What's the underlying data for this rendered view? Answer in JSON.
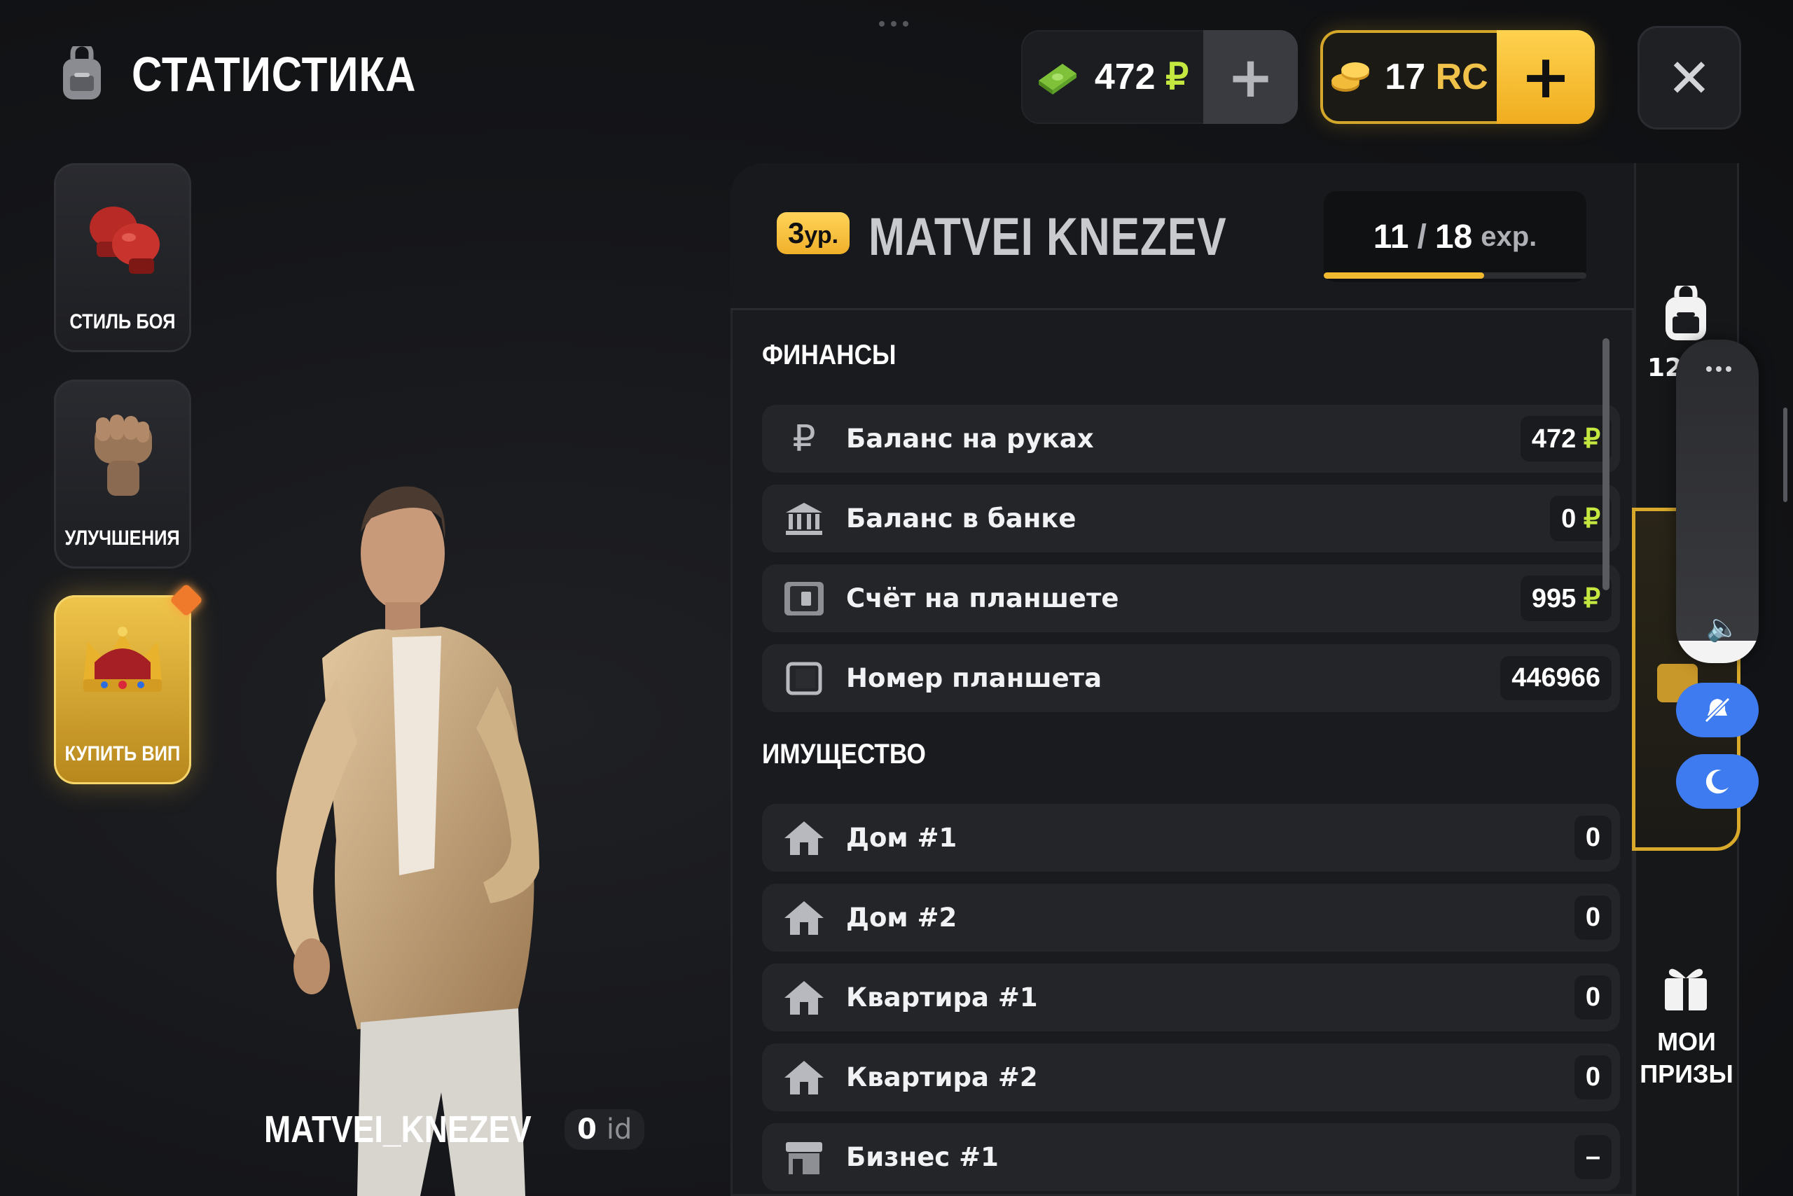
{
  "header": {
    "title": "СТАТИСТИКА"
  },
  "currency": {
    "money_value": "472",
    "money_symbol": "₽",
    "rc_value": "17",
    "rc_symbol": "RC",
    "plus": "+"
  },
  "close_label": "✕",
  "menu": [
    {
      "label": "СТИЛЬ БОЯ",
      "icon": "boxing-gloves-icon"
    },
    {
      "label": "УЛУЧШЕНИЯ",
      "icon": "fist-icon"
    },
    {
      "label": "КУПИТЬ ВИП",
      "icon": "crown-icon"
    }
  ],
  "player": {
    "name": "MATVEI_KNEZEV",
    "id_value": "0",
    "id_word": "id"
  },
  "panel": {
    "level_num": "3",
    "level_suffix": "ур.",
    "title": "MATVEI KNEZEV",
    "exp_current": "11",
    "exp_sep": "/",
    "exp_total": "18",
    "exp_word": "exp.",
    "exp_progress": 0.611
  },
  "finances": {
    "title": "ФИНАНСЫ",
    "rows": [
      {
        "label": "Баланс на руках",
        "value": "472",
        "suffix": "₽",
        "icon": "ruble-icon"
      },
      {
        "label": "Баланс в банке",
        "value": "0",
        "suffix": "₽",
        "icon": "bank-icon"
      },
      {
        "label": "Счёт на планшете",
        "value": "995",
        "suffix": "₽",
        "icon": "tablet-wallet-icon"
      },
      {
        "label": "Номер планшета",
        "value": "446966",
        "suffix": "",
        "icon": "tablet-icon"
      }
    ]
  },
  "property": {
    "title": "ИМУЩЕСТВО",
    "rows": [
      {
        "label": "Дом #1",
        "value": "0",
        "icon": "house-icon"
      },
      {
        "label": "Дом #2",
        "value": "0",
        "icon": "house-icon"
      },
      {
        "label": "Квартира #1",
        "value": "0",
        "icon": "house-icon"
      },
      {
        "label": "Квартира #2",
        "value": "0",
        "icon": "house-icon"
      },
      {
        "label": "Бизнес #1",
        "value": "–",
        "icon": "shop-icon"
      }
    ]
  },
  "sidebar": {
    "inventory_count": "12",
    "prizes_line1": "МОИ",
    "prizes_line2": "ПРИЗЫ"
  },
  "system": {
    "volume_level": 0.07
  },
  "colors": {
    "accent_gold": "#f1b930",
    "ruble_green": "#c5e840",
    "blue": "#3e7bf0"
  }
}
